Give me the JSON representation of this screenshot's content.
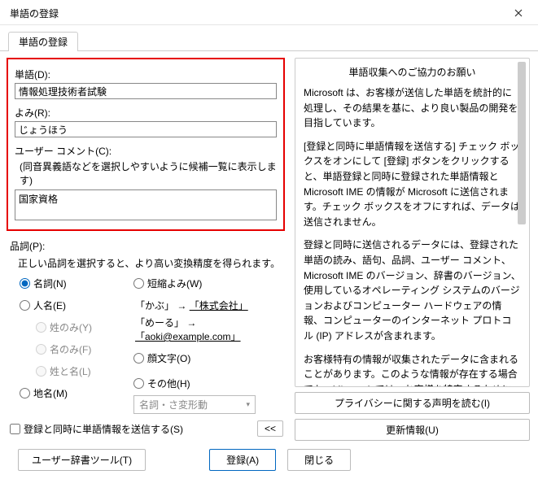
{
  "window": {
    "title": "単語の登録"
  },
  "tab": {
    "label": "単語の登録"
  },
  "fields": {
    "word_label": "単語(D):",
    "word_value": "情報処理技術者試験",
    "reading_label": "よみ(R):",
    "reading_value": "じょうほう",
    "comment_label": "ユーザー コメント(C):",
    "comment_hint": "(同音異義語などを選択しやすいように候補一覧に表示します)",
    "comment_value": "国家資格"
  },
  "pos": {
    "label": "品詞(P):",
    "hint": "正しい品詞を選択すると、より高い変換精度を得られます。",
    "noun": "名詞(N)",
    "person": "人名(E)",
    "surname_only": "姓のみ(Y)",
    "given_only": "名のみ(F)",
    "surname_given": "姓と名(L)",
    "place": "地名(M)",
    "short": "短縮よみ(W)",
    "example1_a": "「かぶ」",
    "example1_b": "「株式会社」",
    "example2_a": "「めーる」",
    "example2_b": "「aoki@example.com」",
    "arrow": "→",
    "kaomoji": "顔文字(O)",
    "other": "その他(H)",
    "dropdown": "名詞・さ変形動"
  },
  "send": {
    "checkbox": "登録と同時に単語情報を送信する(S)",
    "expand": "<<"
  },
  "info": {
    "title": "単語収集へのご協力のお願い",
    "p1": "Microsoft は、お客様が送信した単語を統計的に処理し、その結果を基に、より良い製品の開発を目指しています。",
    "p2": "[登録と同時に単語情報を送信する] チェック ボックスをオンにして [登録] ボタンをクリックすると、単語登録と同時に登録された単語情報と Microsoft IME の情報が Microsoft に送信されます。チェック ボックスをオフにすれば、データは送信されません。",
    "p3": "登録と同時に送信されるデータには、登録された単語の読み、語句、品詞、ユーザー コメント、Microsoft IME のバージョン、辞書のバージョン、使用しているオペレーティング システムのバージョンおよびコンピューター ハードウェアの情報、コンピューターのインターネット プロトコル (IP) アドレスが含まれます。",
    "p4": "お客様特有の情報が収集されたデータに含まれることがあります。このような情報が存在する場合でも、Microsoft では、お客様を特定するために使用することはありません。"
  },
  "buttons": {
    "privacy": "プライバシーに関する声明を読む(I)",
    "update": "更新情報(U)",
    "user_dict": "ユーザー辞書ツール(T)",
    "register": "登録(A)",
    "close": "閉じる"
  }
}
